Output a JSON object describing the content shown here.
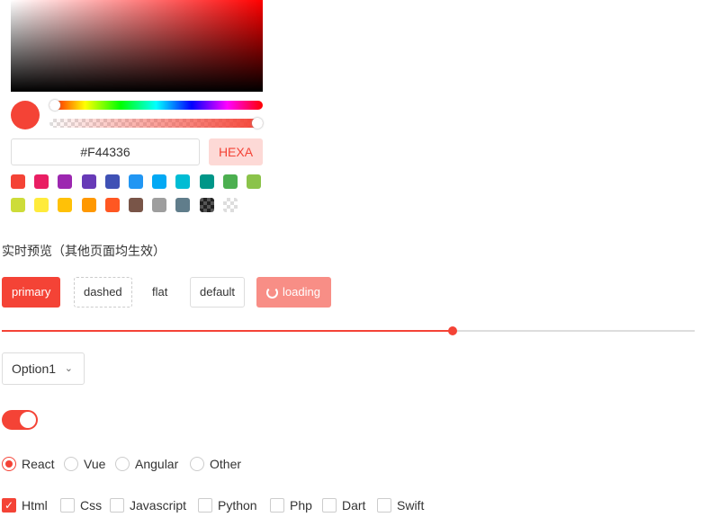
{
  "picker": {
    "hex": "#F44336",
    "mode": "HEXA",
    "hue": 0,
    "alpha": 1,
    "swatches": [
      "#F44336",
      "#E91E63",
      "#9C27B0",
      "#673AB7",
      "#3F51B5",
      "#2196F3",
      "#03A9F4",
      "#00BCD4",
      "#009688",
      "#4CAF50",
      "#8BC34A",
      "#CDDC39",
      "#FFEB3B",
      "#FFC107",
      "#FF9800",
      "#FF5722",
      "#795548",
      "#9E9E9E",
      "#607D8B",
      "#333333",
      "transparent"
    ]
  },
  "preview_title": "实时预览（其他页面均生效）",
  "buttons": {
    "primary": "primary",
    "dashed": "dashed",
    "flat": "flat",
    "default": "default",
    "loading": "loading"
  },
  "slider": {
    "value": 65
  },
  "select": {
    "value": "Option1"
  },
  "switch": {
    "on": true
  },
  "radios": [
    {
      "label": "React",
      "checked": true
    },
    {
      "label": "Vue"
    },
    {
      "label": "Angular"
    },
    {
      "label": "Other"
    }
  ],
  "checkboxes": [
    {
      "label": "Html",
      "checked": true
    },
    {
      "label": "Css"
    },
    {
      "label": "Javascript"
    },
    {
      "label": "Python"
    },
    {
      "label": "Php"
    },
    {
      "label": "Dart"
    },
    {
      "label": "Swift"
    }
  ]
}
